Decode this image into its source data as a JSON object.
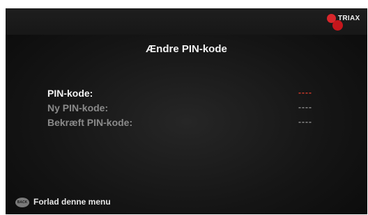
{
  "brand": {
    "name": "TRIAX"
  },
  "menu": {
    "title": "Ændre PIN-kode",
    "rows": [
      {
        "label": "PIN-kode:",
        "value": "----"
      },
      {
        "label": "Ny PIN-kode:",
        "value": "----"
      },
      {
        "label": "Bekræft PIN-kode:",
        "value": "----"
      }
    ]
  },
  "footer": {
    "back_icon_label": "BACK",
    "text": "Forlad denne menu"
  },
  "colors": {
    "active_value": "#d23a2a",
    "inactive_text": "#8a8a8a",
    "brand_red": "#d8262b"
  }
}
